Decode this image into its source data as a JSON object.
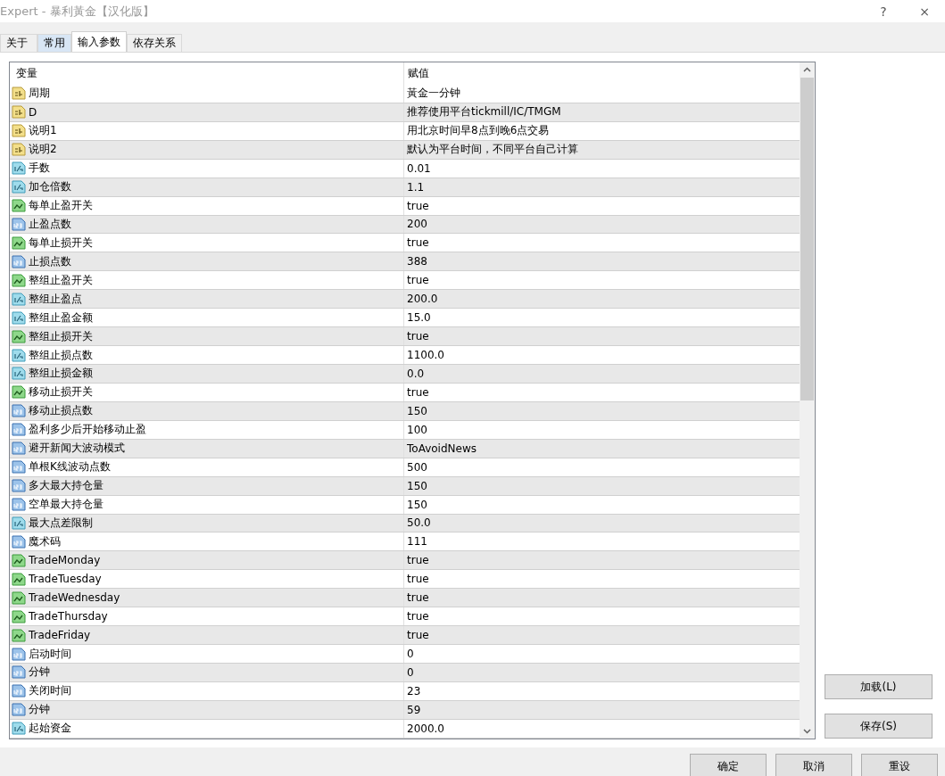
{
  "window": {
    "title": "Expert - 暴利黃金【汉化版】",
    "help": "?",
    "close": "×"
  },
  "tabs": [
    {
      "label": "关于",
      "selected": false
    },
    {
      "label": "常用",
      "selected": false
    },
    {
      "label": "输入参数",
      "selected": true
    },
    {
      "label": "依存关系",
      "selected": false
    }
  ],
  "table": {
    "columns": [
      "变量",
      "赋值"
    ],
    "rows": [
      {
        "kind": "string",
        "name": "周期",
        "value": "黃金一分钟"
      },
      {
        "kind": "string",
        "name": "D",
        "value": "推荐使用平台tickmill/IC/TMGM"
      },
      {
        "kind": "string",
        "name": "说明1",
        "value": "用北京时间早8点到晚6点交易"
      },
      {
        "kind": "string",
        "name": "说明2",
        "value": "默认为平台时间，不同平台自己计算"
      },
      {
        "kind": "double",
        "name": "手数",
        "value": "0.01"
      },
      {
        "kind": "double",
        "name": "加仓倍数",
        "value": "1.1"
      },
      {
        "kind": "bool",
        "name": "每单止盈开关",
        "value": "true"
      },
      {
        "kind": "int",
        "name": "止盈点数",
        "value": "200"
      },
      {
        "kind": "bool",
        "name": "每单止损开关",
        "value": "true"
      },
      {
        "kind": "int",
        "name": "止损点数",
        "value": "388"
      },
      {
        "kind": "bool",
        "name": "整组止盈开关",
        "value": "true"
      },
      {
        "kind": "double",
        "name": "整组止盈点",
        "value": "200.0"
      },
      {
        "kind": "double",
        "name": "整组止盈金额",
        "value": "15.0"
      },
      {
        "kind": "bool",
        "name": "整组止损开关",
        "value": "true"
      },
      {
        "kind": "double",
        "name": "整组止损点数",
        "value": "1100.0"
      },
      {
        "kind": "double",
        "name": "整组止损金额",
        "value": "0.0"
      },
      {
        "kind": "bool",
        "name": "移动止损开关",
        "value": "true"
      },
      {
        "kind": "int",
        "name": "移动止损点数",
        "value": "150"
      },
      {
        "kind": "int",
        "name": "盈利多少后开始移动止盈",
        "value": "100"
      },
      {
        "kind": "int",
        "name": "避开新闻大波动模式",
        "value": "ToAvoidNews"
      },
      {
        "kind": "int",
        "name": "单根K线波动点数",
        "value": "500"
      },
      {
        "kind": "int",
        "name": "多大最大持仓量",
        "value": "150"
      },
      {
        "kind": "int",
        "name": "空单最大持仓量",
        "value": "150"
      },
      {
        "kind": "double",
        "name": "最大点差限制",
        "value": "50.0"
      },
      {
        "kind": "int",
        "name": "魔术码",
        "value": "111"
      },
      {
        "kind": "bool",
        "name": "TradeMonday",
        "value": "true"
      },
      {
        "kind": "bool",
        "name": "TradeTuesday",
        "value": "true"
      },
      {
        "kind": "bool",
        "name": "TradeWednesday",
        "value": "true"
      },
      {
        "kind": "bool",
        "name": "TradeThursday",
        "value": "true"
      },
      {
        "kind": "bool",
        "name": "TradeFriday",
        "value": "true"
      },
      {
        "kind": "int",
        "name": "启动时间",
        "value": "0"
      },
      {
        "kind": "int",
        "name": "分钟",
        "value": "0"
      },
      {
        "kind": "int",
        "name": "关闭时间",
        "value": "23"
      },
      {
        "kind": "int",
        "name": "分钟",
        "value": "59"
      },
      {
        "kind": "double",
        "name": "起始资金",
        "value": "2000.0"
      }
    ]
  },
  "side_buttons": [
    "加载(L)",
    "保存(S)"
  ],
  "buttons": [
    "确定",
    "取消",
    "重设"
  ]
}
